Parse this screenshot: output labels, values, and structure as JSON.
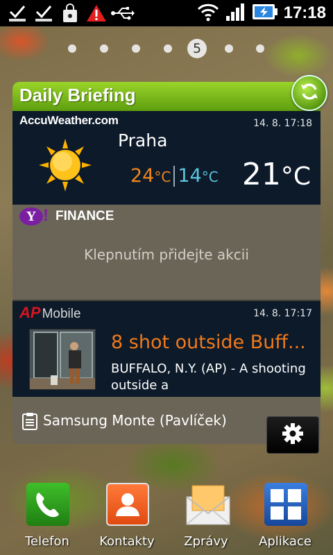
{
  "status_bar": {
    "icons": [
      "download-done-icon",
      "download-done-icon",
      "shopping-bag-icon",
      "warning-icon",
      "usb-icon",
      "wifi-icon",
      "signal-icon",
      "battery-charging-icon"
    ],
    "time": "17:18"
  },
  "home": {
    "current_page": "5",
    "page_count": 7
  },
  "widget": {
    "title": "Daily Briefing",
    "weather": {
      "provider": "AccuWeather.com",
      "updated": "14. 8. 17:18",
      "city": "Praha",
      "high": "24",
      "low": "14",
      "current": "21",
      "unit": "°C",
      "condition_icon": "sun-icon"
    },
    "finance": {
      "provider": "FINANCE",
      "message": "Klepnutím přidejte akcii"
    },
    "news": {
      "provider_ap": "AP",
      "provider_mobile": "Mobile",
      "updated": "14. 8. 17:17",
      "headline": "8 shot outside Buff...",
      "summary": "BUFFALO, N.Y. (AP) - A shooting outside a"
    },
    "footer": {
      "label": "Samsung Monte (Pavlíček)"
    }
  },
  "dock": {
    "apps": [
      {
        "label": "Telefon",
        "icon": "phone-icon",
        "color": "#2e9e1e"
      },
      {
        "label": "Kontakty",
        "icon": "contacts-icon",
        "color": "#f05a1e"
      },
      {
        "label": "Zprávy",
        "icon": "messages-icon",
        "color": "#f2b24a"
      },
      {
        "label": "Aplikace",
        "icon": "apps-grid-icon",
        "color": "#1f5fbf"
      }
    ]
  },
  "colors": {
    "header_green": "#7fbf1c",
    "high_temp": "#f0851e",
    "low_temp": "#5cc6e0",
    "headline": "#f07a1a"
  }
}
